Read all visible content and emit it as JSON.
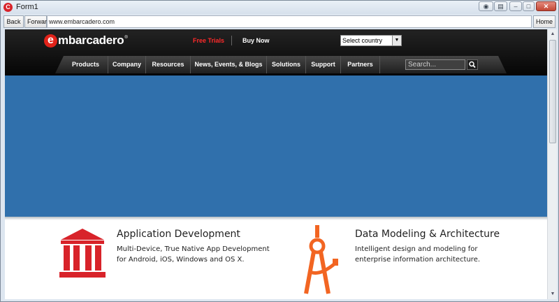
{
  "window": {
    "title": "Form1",
    "app_icon": "C",
    "controls": [
      "eye-icon",
      "pin-icon",
      "minimize-icon",
      "maximize-icon",
      "close-icon"
    ]
  },
  "toolbar": {
    "back_label": "Back",
    "forward_label": "Forward",
    "url": "www.embarcadero.com",
    "home_label": "Home"
  },
  "site": {
    "logo_letter": "e",
    "logo_text": "mbarcadero",
    "logo_mark": "®",
    "free_trials": "Free Trials",
    "buy_now": "Buy Now",
    "country_select": "Select country",
    "nav": [
      "Products",
      "Company",
      "Resources",
      "News, Events, & Blogs",
      "Solutions",
      "Support",
      "Partners"
    ],
    "search_placeholder": "Search...",
    "accent_color": "#e2231a",
    "hero_color": "#3070ac"
  },
  "features": [
    {
      "title": "Application Development",
      "desc_line1": "Multi-Device, True Native App Development",
      "desc_line2": "for Android, iOS, Windows and OS X.",
      "icon": "building-columns-icon",
      "icon_color": "#d8232a"
    },
    {
      "title": "Data Modeling & Architecture",
      "desc_line1": "Intelligent design and modeling for",
      "desc_line2": "enterprise information architecture.",
      "icon": "drafting-compass-icon",
      "icon_color": "#f26522"
    }
  ]
}
